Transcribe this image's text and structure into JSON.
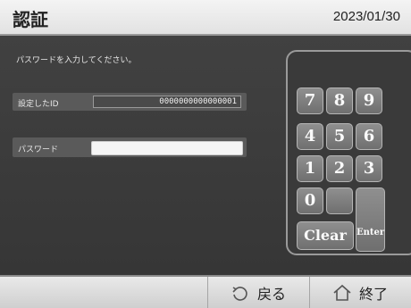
{
  "header": {
    "title": "認証",
    "date": "2023/01/30"
  },
  "main": {
    "instruction": "パスワードを入力してください。",
    "id_field": {
      "label": "設定したID",
      "value": "0000000000000001"
    },
    "password_field": {
      "label": "パスワード",
      "value": ""
    }
  },
  "keypad": {
    "keys": {
      "k7": "7",
      "k8": "8",
      "k9": "9",
      "k4": "4",
      "k5": "5",
      "k6": "6",
      "k1": "1",
      "k2": "2",
      "k3": "3",
      "k0": "0",
      "clear": "Clear",
      "enter": "Enter"
    }
  },
  "footer": {
    "back_label": "戻る",
    "exit_label": "終了",
    "back_icon": "undo-arrow-icon",
    "exit_icon": "home-icon"
  },
  "colors": {
    "background": "#3b3b3b",
    "header_bg": "#eeeeee",
    "key_bg": "#7d7d7d",
    "footer_bg": "#dcdcdc"
  }
}
